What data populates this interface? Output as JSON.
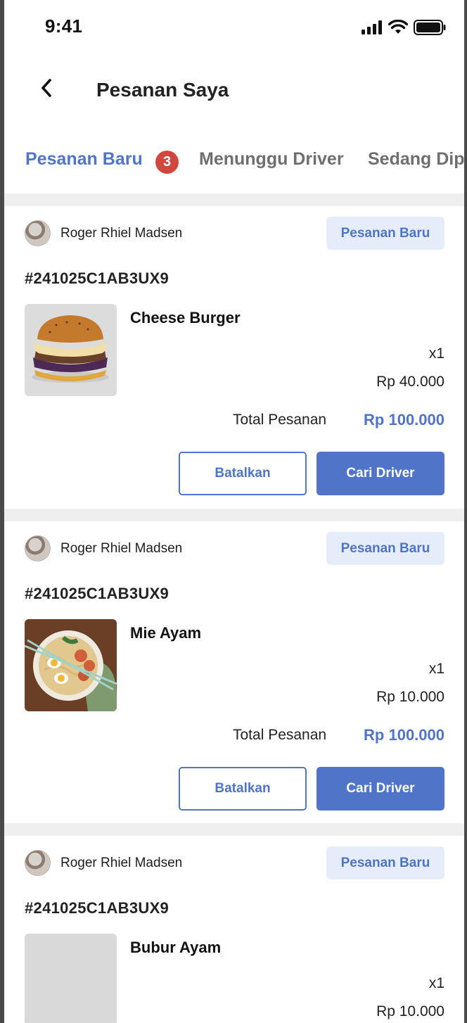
{
  "status_bar": {
    "time": "9:41"
  },
  "header": {
    "title": "Pesanan Saya"
  },
  "tabs": [
    {
      "label": "Pesanan Baru",
      "badge": "3",
      "active": true
    },
    {
      "label": "Menunggu Driver",
      "active": false
    },
    {
      "label": "Sedang Dip",
      "active": false
    }
  ],
  "orders": [
    {
      "seller": "Roger Rhiel Madsen",
      "status": "Pesanan Baru",
      "order_id": "#241025C1AB3UX9",
      "item": "Cheese Burger",
      "qty": "x1",
      "price": "Rp 40.000",
      "total_label": "Total Pesanan",
      "total": "Rp 100.000",
      "cancel_label": "Batalkan",
      "action_label": "Cari Driver",
      "image": "burger"
    },
    {
      "seller": "Roger Rhiel Madsen",
      "status": "Pesanan Baru",
      "order_id": "#241025C1AB3UX9",
      "item": "Mie Ayam",
      "qty": "x1",
      "price": "Rp 10.000",
      "total_label": "Total Pesanan",
      "total": "Rp 100.000",
      "cancel_label": "Batalkan",
      "action_label": "Cari Driver",
      "image": "noodles"
    },
    {
      "seller": "Roger Rhiel Madsen",
      "status": "Pesanan Baru",
      "order_id": "#241025C1AB3UX9",
      "item": "Bubur Ayam",
      "qty": "x1",
      "price": "Rp 10.000",
      "image": "placeholder"
    }
  ],
  "colors": {
    "accent": "#4f74c8",
    "badge": "#d1473d",
    "pill_bg": "#e5edfb",
    "divider": "#efefef"
  }
}
